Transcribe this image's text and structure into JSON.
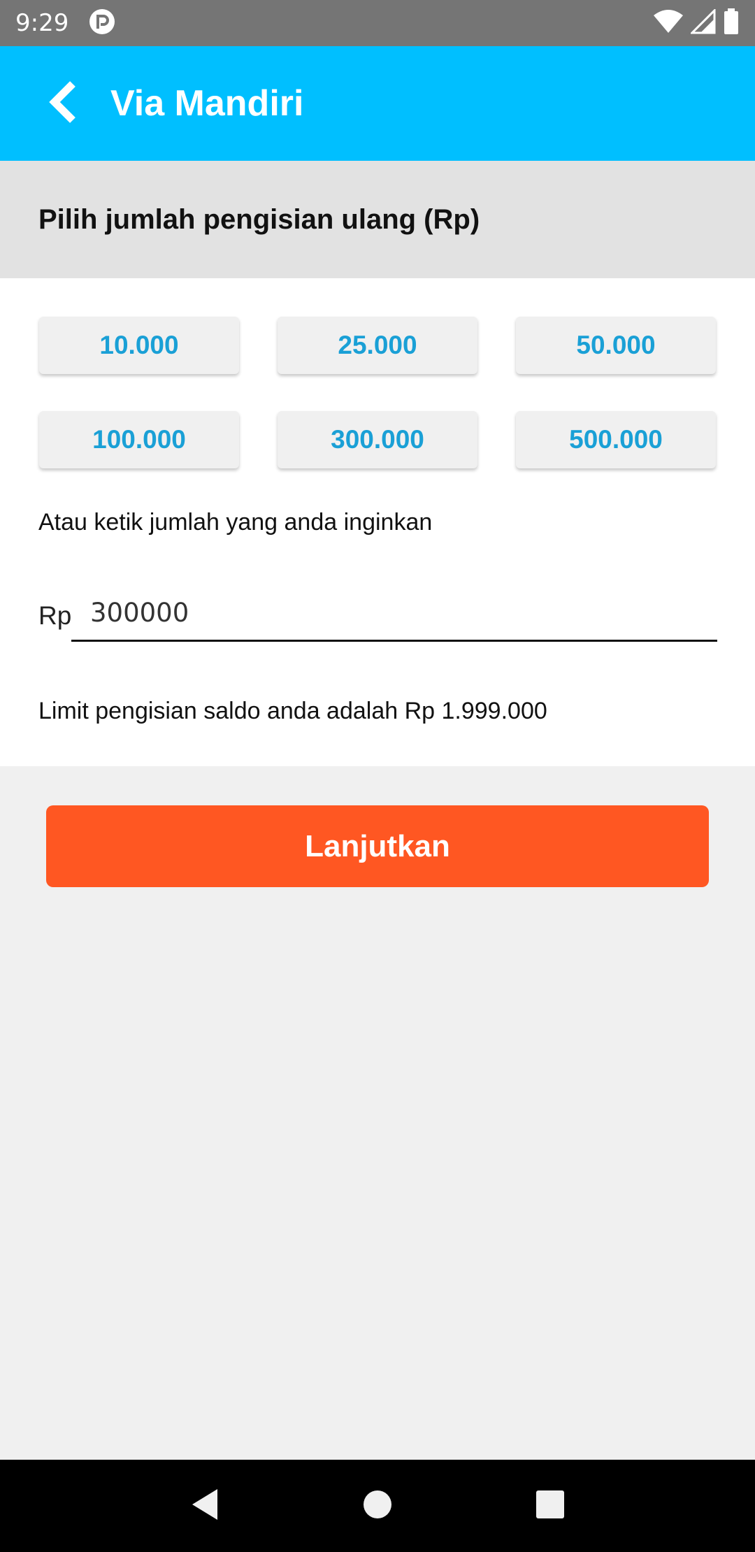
{
  "status_bar": {
    "time": "9:29",
    "left_icon": "pocket-app-icon",
    "right_icons": [
      "wifi-icon",
      "signal-icon",
      "battery-icon"
    ]
  },
  "app_bar": {
    "title": "Via Mandiri",
    "back_icon": "chevron-left-icon",
    "color": "#00bfff"
  },
  "section": {
    "title": "Pilih jumlah pengisian ulang (Rp)"
  },
  "amount_options": [
    "10.000",
    "25.000",
    "50.000",
    "100.000",
    "300.000",
    "500.000"
  ],
  "custom_amount": {
    "hint": "Atau ketik jumlah yang anda inginkan",
    "currency_label": "Rp",
    "value": "300000"
  },
  "limit_text": "Limit pengisian saldo anda adalah Rp 1.999.000",
  "primary_button": {
    "label": "Lanjutkan",
    "color": "#ff5722"
  },
  "nav_bar": {
    "buttons": [
      "back-triangle-icon",
      "home-circle-icon",
      "recents-square-icon"
    ]
  }
}
